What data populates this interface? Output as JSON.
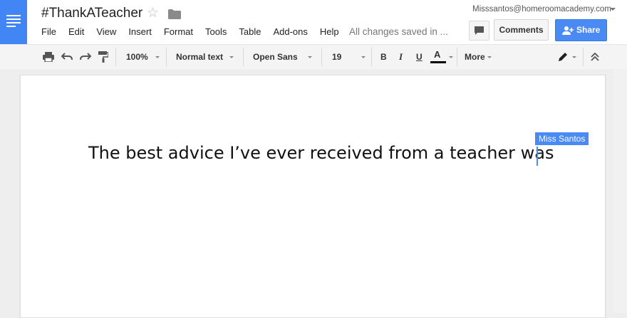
{
  "document": {
    "title": "#ThankATeacher",
    "saved_status": "All changes saved in ...",
    "body_text": "The best advice I’ve ever received from a teacher was",
    "collaborator_cursor_label": "Miss Santos"
  },
  "account": {
    "email": "Misssantos@homeroomacademy.com"
  },
  "menu": [
    "File",
    "Edit",
    "View",
    "Insert",
    "Format",
    "Tools",
    "Table",
    "Add-ons",
    "Help"
  ],
  "buttons": {
    "comments": "Comments",
    "share": "Share"
  },
  "toolbar": {
    "zoom": "100%",
    "style": "Normal text",
    "font": "Open Sans",
    "size": "19",
    "bold": "B",
    "italic": "I",
    "underline": "U",
    "text_color": "A",
    "more": "More"
  },
  "icons": [
    "docs-logo-icon",
    "star-icon",
    "folder-icon",
    "comment-icon",
    "share-person-icon",
    "print-icon",
    "undo-icon",
    "redo-icon",
    "paint-format-icon",
    "edit-mode-pencil-icon",
    "collapse-toolbar-icon"
  ],
  "colors": {
    "brand_blue": "#4285f4",
    "share_blue": "#4a8af4",
    "text_color_underline": "#000000"
  }
}
